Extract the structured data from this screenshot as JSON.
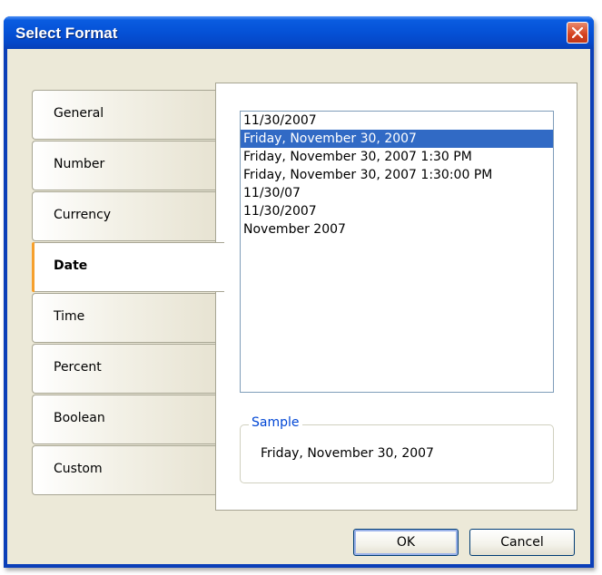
{
  "window": {
    "title": "Select Format"
  },
  "tabs": [
    {
      "label": "General"
    },
    {
      "label": "Number"
    },
    {
      "label": "Currency"
    },
    {
      "label": "Date",
      "active": true
    },
    {
      "label": "Time"
    },
    {
      "label": "Percent"
    },
    {
      "label": "Boolean"
    },
    {
      "label": "Custom"
    }
  ],
  "formats": [
    "11/30/2007",
    "Friday, November 30, 2007",
    "Friday, November 30, 2007 1:30 PM",
    "Friday, November 30, 2007 1:30:00 PM",
    "11/30/07",
    "11/30/2007",
    "November 2007"
  ],
  "selected_format": "Friday, November 30, 2007",
  "sample": {
    "legend": "Sample",
    "value": "Friday, November 30, 2007"
  },
  "buttons": {
    "ok": "OK",
    "cancel": "Cancel"
  },
  "colors": {
    "selection": "#316ac5",
    "active_tab_marker": "#f6a02e",
    "title_bar": "#0551d6",
    "dialog_face": "#ece9d8",
    "sample_legend": "#0046d5"
  },
  "icons": {
    "close": "close-icon"
  }
}
